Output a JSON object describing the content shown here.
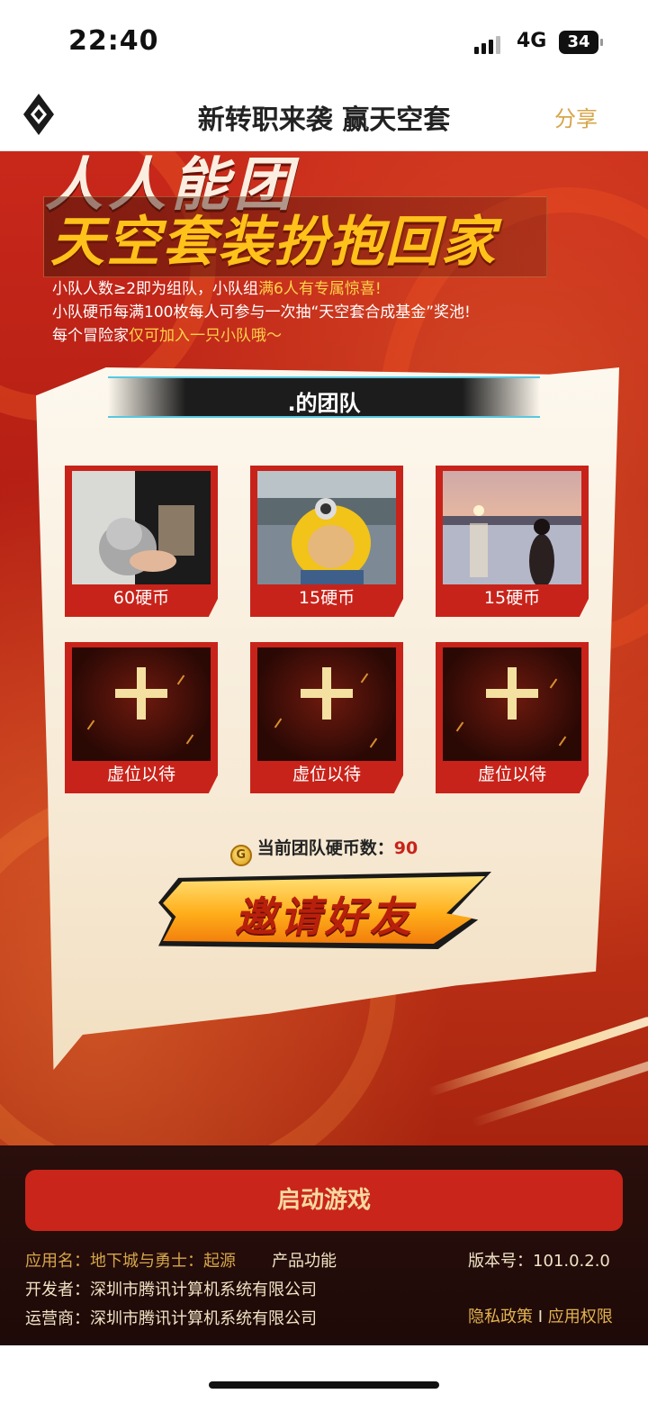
{
  "status": {
    "time": "22:40",
    "network": "4G",
    "battery": "34"
  },
  "nav": {
    "title": "新转职来袭 赢天空套",
    "share": "分享"
  },
  "poster": {
    "headline_top": "人人能团",
    "headline": "天空套装扮抱回家",
    "rules": [
      {
        "plain": "小队人数≥2即为组队，小队组",
        "highlight": "满6人有专属惊喜!"
      },
      {
        "plain": "小队硬币每满100枚每人可参与一次抽“天空套合成基金”奖池!",
        "highlight": ""
      },
      {
        "plain": "每个冒险家",
        "highlight": "仅可加入一只小队哦～"
      }
    ]
  },
  "team": {
    "name": ".的团队",
    "members": [
      {
        "caption": "60硬币"
      },
      {
        "caption": "15硬币"
      },
      {
        "caption": "15硬币"
      }
    ],
    "empty_slots": [
      {
        "caption": "虚位以待"
      },
      {
        "caption": "虚位以待"
      },
      {
        "caption": "虚位以待"
      }
    ],
    "coins_label": "当前团队硬币数：",
    "coins_value": "90",
    "invite_label": "邀请好友"
  },
  "footer": {
    "launch_label": "启动游戏",
    "app_name_key": "应用名：",
    "app_name_value": "地下城与勇士：起源",
    "features": "产品功能",
    "version_key": "版本号：",
    "version_value": "101.0.2.0",
    "developer_key": "开发者：",
    "developer_value": "深圳市腾讯计算机系统有限公司",
    "operator_key": "运营商：",
    "operator_value": "深圳市腾讯计算机系统有限公司",
    "privacy": "隐私政策",
    "separator": "I",
    "permissions": "应用权限"
  },
  "colors": {
    "accent_red": "#c9251a",
    "gold": "#d6a64a",
    "highlight_yellow": "#ffd24a"
  },
  "icons": [
    "signal-icon",
    "battery-icon",
    "app-logo-icon",
    "coin-icon",
    "plus-icon"
  ]
}
